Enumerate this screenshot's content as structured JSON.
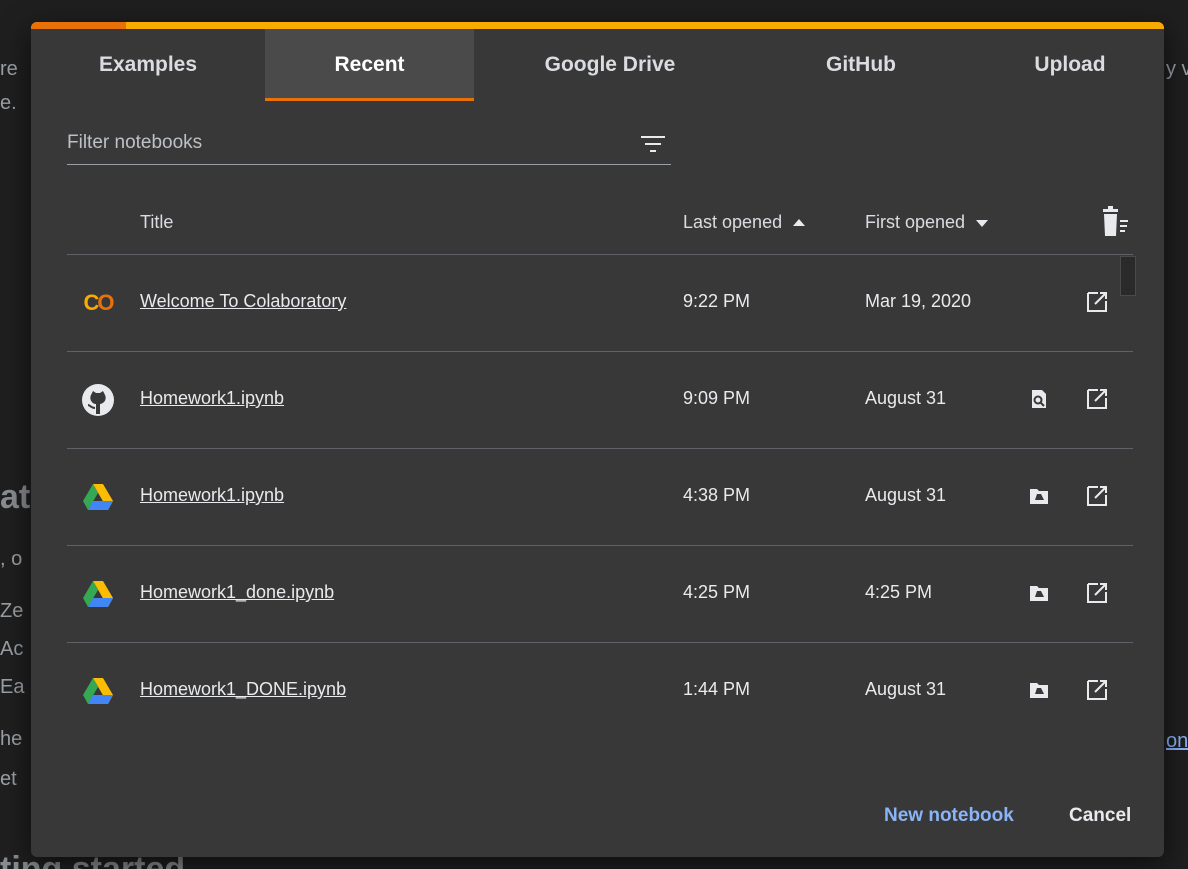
{
  "background": {
    "fragments": [
      "re",
      "e.",
      "at",
      ", o",
      "Ze",
      "Ac",
      "Ea",
      "he",
      "et",
      "y v",
      "on",
      "ting started"
    ]
  },
  "dialog": {
    "tabs": [
      {
        "label": "Examples",
        "active": false
      },
      {
        "label": "Recent",
        "active": true
      },
      {
        "label": "Google Drive",
        "active": false
      },
      {
        "label": "GitHub",
        "active": false
      },
      {
        "label": "Upload",
        "active": false
      }
    ],
    "filter": {
      "placeholder": "Filter notebooks",
      "value": ""
    },
    "table": {
      "headers": {
        "title": "Title",
        "last_opened": "Last opened",
        "first_opened": "First opened"
      },
      "rows": [
        {
          "icon": "colab-logo-icon",
          "title": "Welcome To Colaboratory",
          "last_opened": "9:22 PM",
          "first_opened": "Mar 19, 2020",
          "actions": [
            "open-new-tab-icon"
          ]
        },
        {
          "icon": "github-icon",
          "title": "Homework1.ipynb",
          "last_opened": "9:09 PM",
          "first_opened": "August 31",
          "actions": [
            "view-source-icon",
            "open-new-tab-icon"
          ]
        },
        {
          "icon": "google-drive-icon",
          "title": "Homework1.ipynb",
          "last_opened": "4:38 PM",
          "first_opened": "August 31",
          "actions": [
            "drive-folder-icon",
            "open-new-tab-icon"
          ]
        },
        {
          "icon": "google-drive-icon",
          "title": "Homework1_done.ipynb",
          "last_opened": "4:25 PM",
          "first_opened": "4:25 PM",
          "actions": [
            "drive-folder-icon",
            "open-new-tab-icon"
          ]
        },
        {
          "icon": "google-drive-icon",
          "title": "Homework1_DONE.ipynb",
          "last_opened": "1:44 PM",
          "first_opened": "August 31",
          "actions": [
            "drive-folder-icon",
            "open-new-tab-icon"
          ]
        }
      ]
    },
    "footer": {
      "new_notebook": "New notebook",
      "cancel": "Cancel"
    },
    "colors": {
      "accent_orange": "#e8710a",
      "accent_yellow": "#f9ab00",
      "link_blue": "#8ab4f8",
      "dialog_bg": "#383838"
    }
  }
}
